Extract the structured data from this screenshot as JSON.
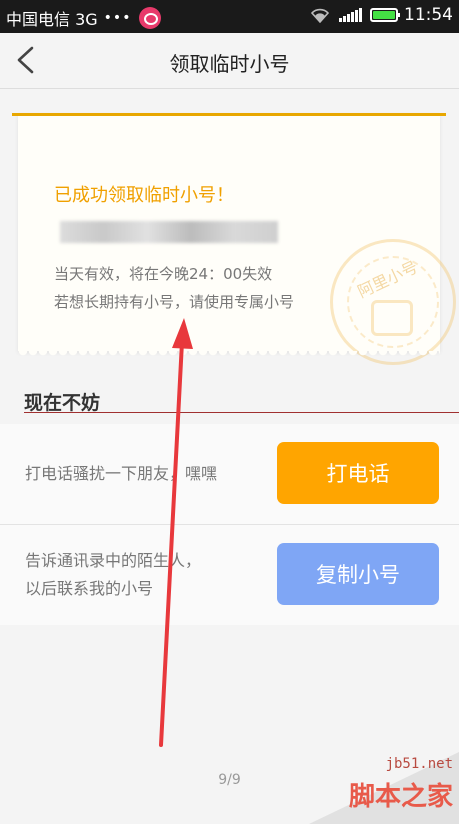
{
  "status_bar": {
    "carrier": "中国电信 3G",
    "dots": "•••",
    "time": "11:54"
  },
  "header": {
    "title": "领取临时小号"
  },
  "ticket": {
    "success_text": "已成功领取临时小号！",
    "valid_text": "当天有效，将在今晚24：00失效",
    "hint_text": "若想长期持有小号，请使用专属小号",
    "stamp_text": "阿里小号"
  },
  "section": {
    "heading": "现在不妨"
  },
  "actions": [
    {
      "text_lines": [
        "打电话骚扰一下朋友，嘿嘿"
      ],
      "button_label": "打电话",
      "button_color": "#ffa500"
    },
    {
      "text_lines": [
        "告诉通讯录中的陌生人，",
        "以后联系我的小号"
      ],
      "button_label": "复制小号",
      "button_color": "#7fa6f5"
    }
  ],
  "pager": "9/9",
  "watermark": {
    "site": "jb51.net",
    "name": "脚本之家"
  },
  "colors": {
    "accent_orange": "#ffa500",
    "accent_blue": "#7fa6f5",
    "arrow_red": "#e8383c"
  }
}
